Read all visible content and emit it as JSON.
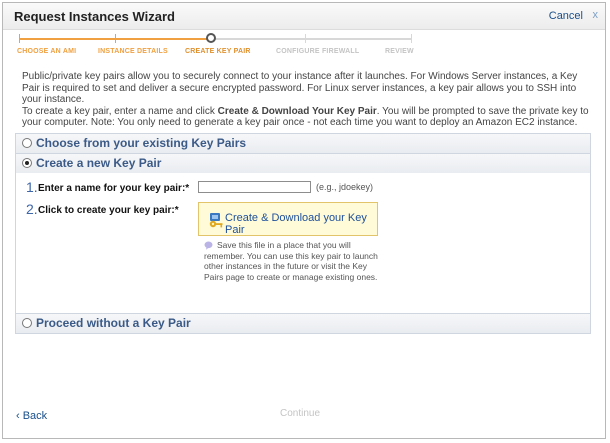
{
  "window": {
    "title": "Request Instances Wizard",
    "cancel_label": "Cancel",
    "close_glyph": "x"
  },
  "steps": [
    {
      "label": "CHOOSE AN AMI",
      "state": "done"
    },
    {
      "label": "INSTANCE DETAILS",
      "state": "done"
    },
    {
      "label": "CREATE KEY PAIR",
      "state": "current"
    },
    {
      "label": "CONFIGURE FIREWALL",
      "state": "todo"
    },
    {
      "label": "REVIEW",
      "state": "todo"
    }
  ],
  "intro": {
    "line1": "Public/private key pairs allow you to securely connect to your instance after it launches. For Windows Server instances, a Key Pair is required to set and deliver a secure encrypted password. For Linux server instances, a key pair allows you to SSH into your instance.",
    "line2_prefix": "To create a key pair, enter a name and click ",
    "line2_bold": "Create & Download Your Key Pair",
    "line2_suffix": ". You will be prompted to save the private key to your computer. Note: You only need to generate a key pair once - not each time you want to deploy an Amazon EC2 instance."
  },
  "options": {
    "existing": {
      "label": "Choose from your existing Key Pairs",
      "selected": false
    },
    "create_new": {
      "label": "Create a new Key Pair",
      "selected": true
    },
    "none": {
      "label": "Proceed without a Key Pair",
      "selected": false
    }
  },
  "create_form": {
    "step1_number": "1.",
    "step1_label": "Enter a name for your key pair:*",
    "key_name_value": "",
    "key_name_hint": "(e.g., jdoekey)",
    "step2_number": "2.",
    "step2_label": "Click to create your key pair:*",
    "create_button_label": "Create & Download your Key Pair",
    "note": "Save this file in a place that you will remember. You can use this key pair to launch other instances in the future or visit the Key Pairs page to create or manage existing ones."
  },
  "footer": {
    "back_label": "‹ Back",
    "continue_label": "Continue"
  },
  "colors": {
    "accent_orange": "#f0a040",
    "link_blue": "#1a4f8a",
    "section_title": "#3b5a87",
    "button_bg": "#fffbd9"
  },
  "icons": {
    "key": "key-icon",
    "info": "info-bubble-icon",
    "radio": "radio-icon"
  }
}
